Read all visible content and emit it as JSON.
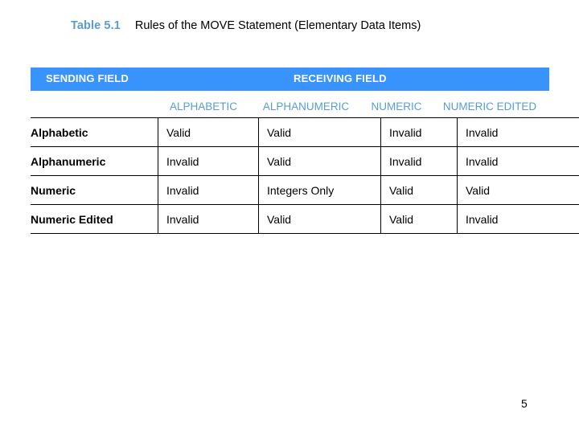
{
  "slide": {
    "title": {
      "label": "Table 5.1",
      "text": "Rules of the MOVE Statement (Elementary Data Items)"
    },
    "page_number": "5",
    "colors": {
      "banner_blue": "#3894fc",
      "heading_blue": "#5b9bd5",
      "text_black": "#000000",
      "background": "#ffffff"
    }
  },
  "banner": {
    "sending_label": "SENDING FIELD",
    "receiving_label": "RECEIVING FIELD"
  },
  "table": {
    "row_header_blank": "",
    "columns": [
      "ALPHABETIC",
      "ALPHANUMERIC",
      "NUMERIC",
      "NUMERIC  EDITED"
    ],
    "rows": [
      {
        "label": "Alphabetic",
        "cells": [
          "Valid",
          "Valid",
          "Invalid",
          "Invalid"
        ]
      },
      {
        "label": "Alphanumeric",
        "cells": [
          "Invalid",
          "Valid",
          "Invalid",
          "Invalid"
        ]
      },
      {
        "label": "Numeric",
        "cells": [
          "Invalid",
          "Integers Only",
          "Valid",
          "Valid"
        ]
      },
      {
        "label": "Numeric Edited",
        "cells": [
          "Invalid",
          "Valid",
          "Valid",
          "Invalid"
        ]
      }
    ]
  }
}
